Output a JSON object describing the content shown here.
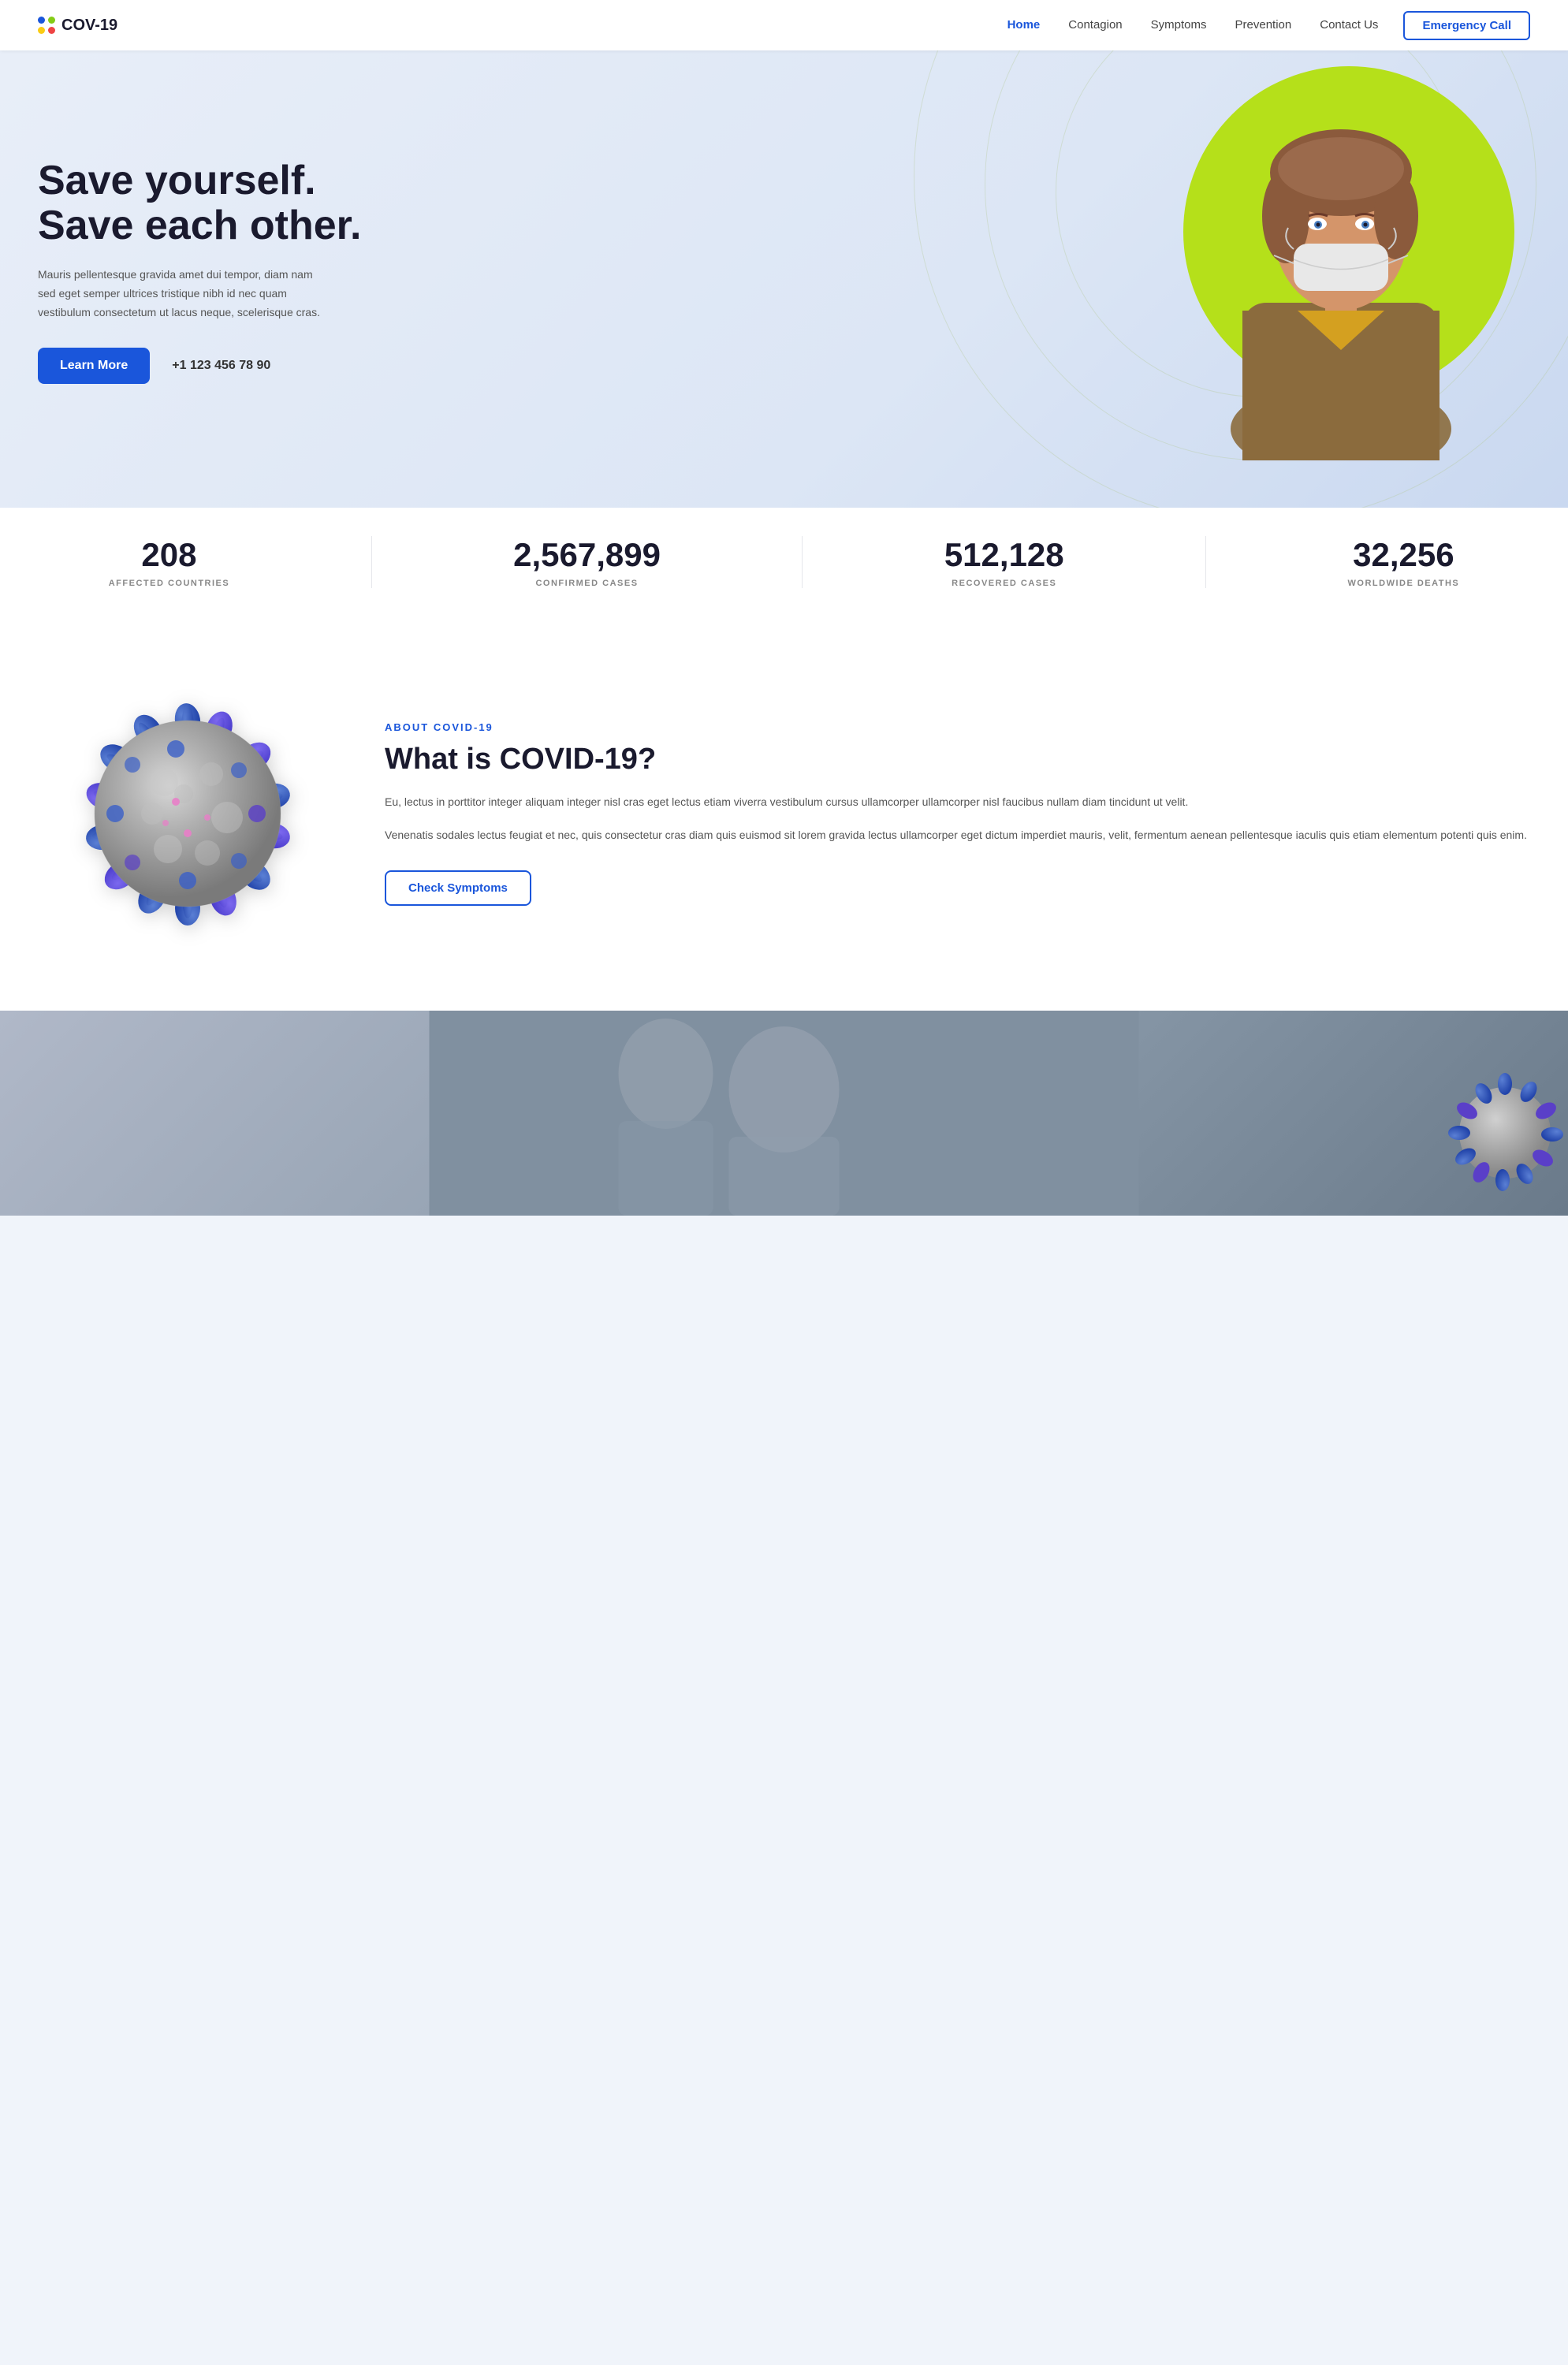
{
  "brand": {
    "name": "COV-19",
    "logo_dots": [
      "blue",
      "green",
      "yellow",
      "red"
    ]
  },
  "nav": {
    "links": [
      {
        "label": "Home",
        "active": true
      },
      {
        "label": "Contagion",
        "active": false
      },
      {
        "label": "Symptoms",
        "active": false
      },
      {
        "label": "Prevention",
        "active": false
      },
      {
        "label": "Contact Us",
        "active": false
      }
    ],
    "emergency_btn": "Emergency Call"
  },
  "hero": {
    "title_line1": "Save yourself.",
    "title_line2": "Save each other.",
    "description": "Mauris pellentesque gravida amet dui tempor, diam nam sed eget semper ultrices tristique nibh id nec quam vestibulum consectetum ut lacus neque, scelerisque cras.",
    "learn_more_btn": "Learn More",
    "phone": "+1 123 456 78 90"
  },
  "stats": [
    {
      "number": "208",
      "label": "Affected Countries"
    },
    {
      "number": "2,567,899",
      "label": "Confirmed Cases"
    },
    {
      "number": "512,128",
      "label": "Recovered Cases"
    },
    {
      "number": "32,256",
      "label": "Worldwide Deaths"
    }
  ],
  "about": {
    "section_label": "About COVID-19",
    "title": "What is COVID-19?",
    "paragraph1": "Eu, lectus in porttitor integer aliquam integer nisl cras eget lectus etiam viverra vestibulum cursus ullamcorper ullamcorper nisl faucibus nullam diam tincidunt ut velit.",
    "paragraph2": "Venenatis sodales lectus feugiat et nec, quis consectetur cras diam quis euismod sit lorem gravida lectus ullamcorper eget dictum imperdiet mauris, velit, fermentum aenean pellentesque iaculis quis etiam elementum potenti quis enim.",
    "check_symptoms_btn": "Check Symptoms"
  },
  "colors": {
    "primary_blue": "#1a56db",
    "accent_green": "#b5e01a",
    "text_dark": "#1a1a2e",
    "text_muted": "#555"
  }
}
